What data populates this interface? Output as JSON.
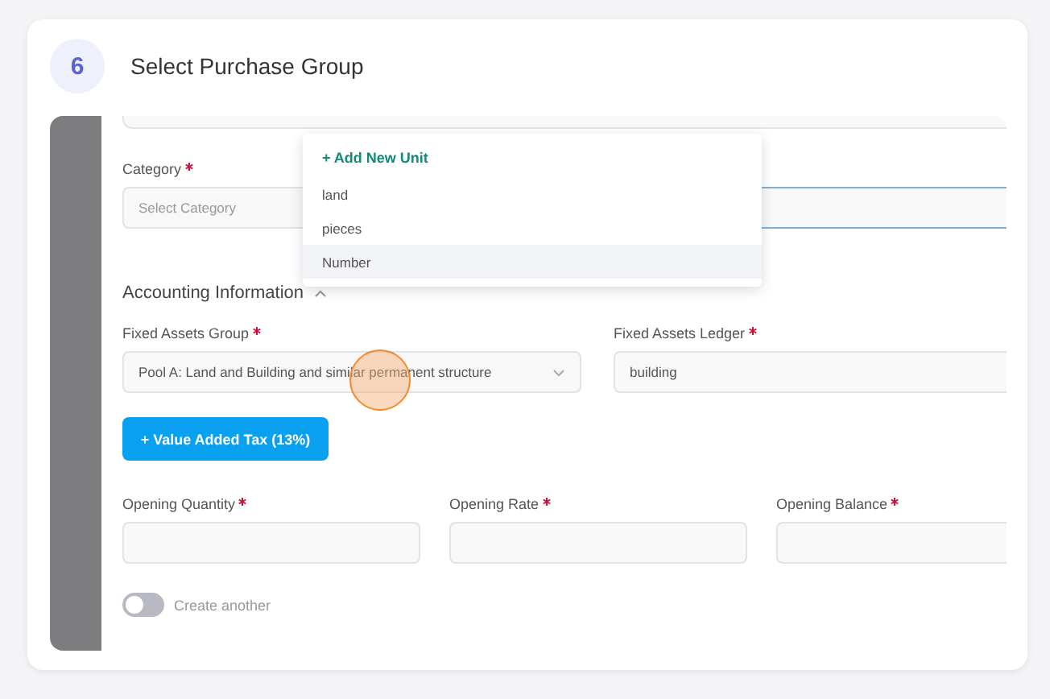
{
  "step": {
    "number": "6",
    "title": "Select Purchase Group"
  },
  "category": {
    "label": "Category",
    "required": true,
    "placeholder": "Select Category"
  },
  "unit_dropdown": {
    "add_label": "+ Add New Unit",
    "options": [
      {
        "label": "land",
        "selected": false
      },
      {
        "label": "pieces",
        "selected": false
      },
      {
        "label": "Number",
        "selected": true
      }
    ]
  },
  "section": {
    "title": "Accounting Information",
    "expanded": true
  },
  "fixed_assets_group": {
    "label": "Fixed Assets Group",
    "required": true,
    "value": "Pool A: Land and Building and similar permanent structure"
  },
  "fixed_assets_ledger": {
    "label": "Fixed Assets Ledger",
    "required": true,
    "value": "building"
  },
  "vat_button": "+ Value Added Tax (13%)",
  "opening_fields": [
    {
      "label": "Opening Quantity",
      "required": true
    },
    {
      "label": "Opening Rate",
      "required": true
    },
    {
      "label": "Opening Balance",
      "required": true
    }
  ],
  "create_another": {
    "label": "Create another",
    "on": false
  }
}
